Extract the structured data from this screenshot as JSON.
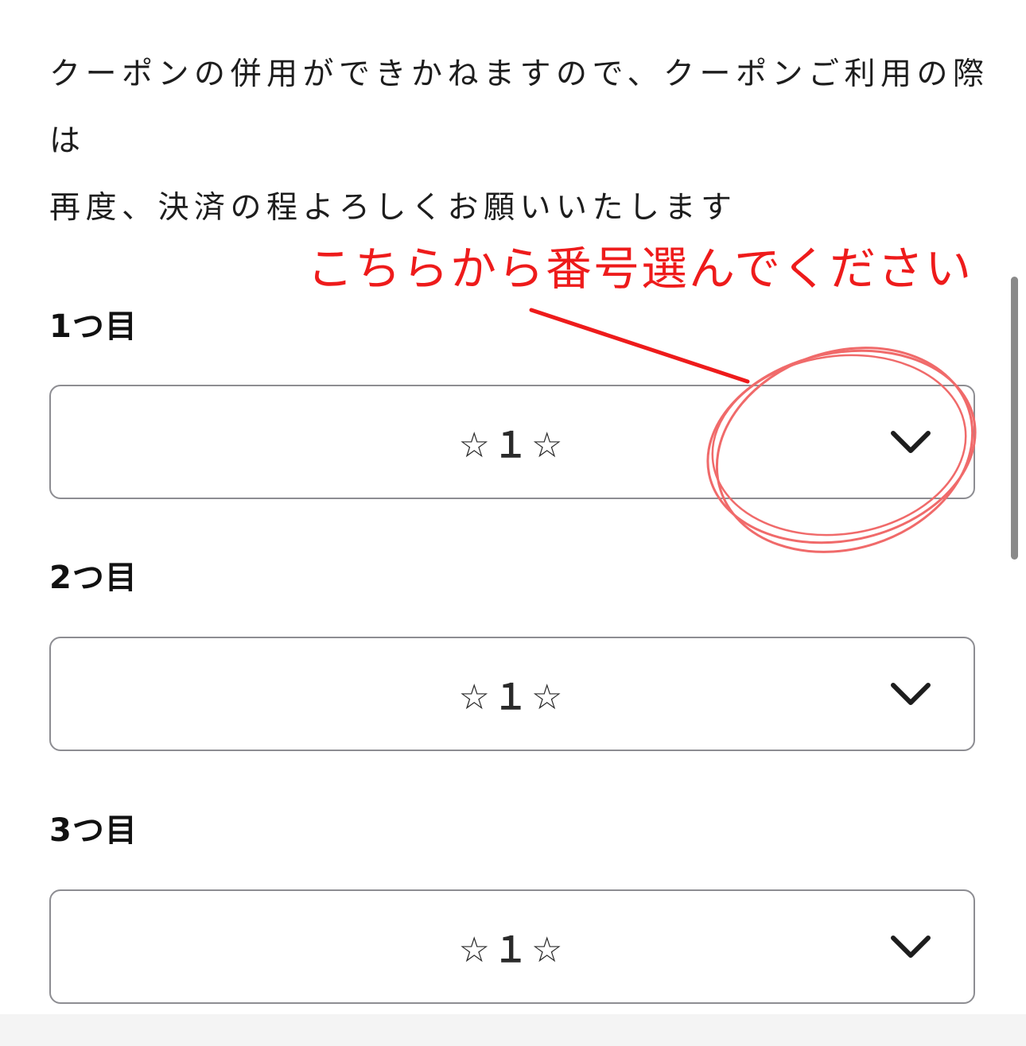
{
  "intro": {
    "line1": "クーポンの併用ができかねますので、クーポンご利用の際",
    "line2": "は",
    "line3": "再度、決済の程よろしくお願いいたします"
  },
  "fields": [
    {
      "label": "1つ目",
      "value": "☆１☆"
    },
    {
      "label": "2つ目",
      "value": "☆１☆"
    },
    {
      "label": "3つ目",
      "value": "☆１☆"
    }
  ],
  "annotation": {
    "text": "こちらから番号選んでください",
    "color": "#ee1b1b"
  },
  "icons": {
    "dropdown": "chevron-down-icon"
  }
}
